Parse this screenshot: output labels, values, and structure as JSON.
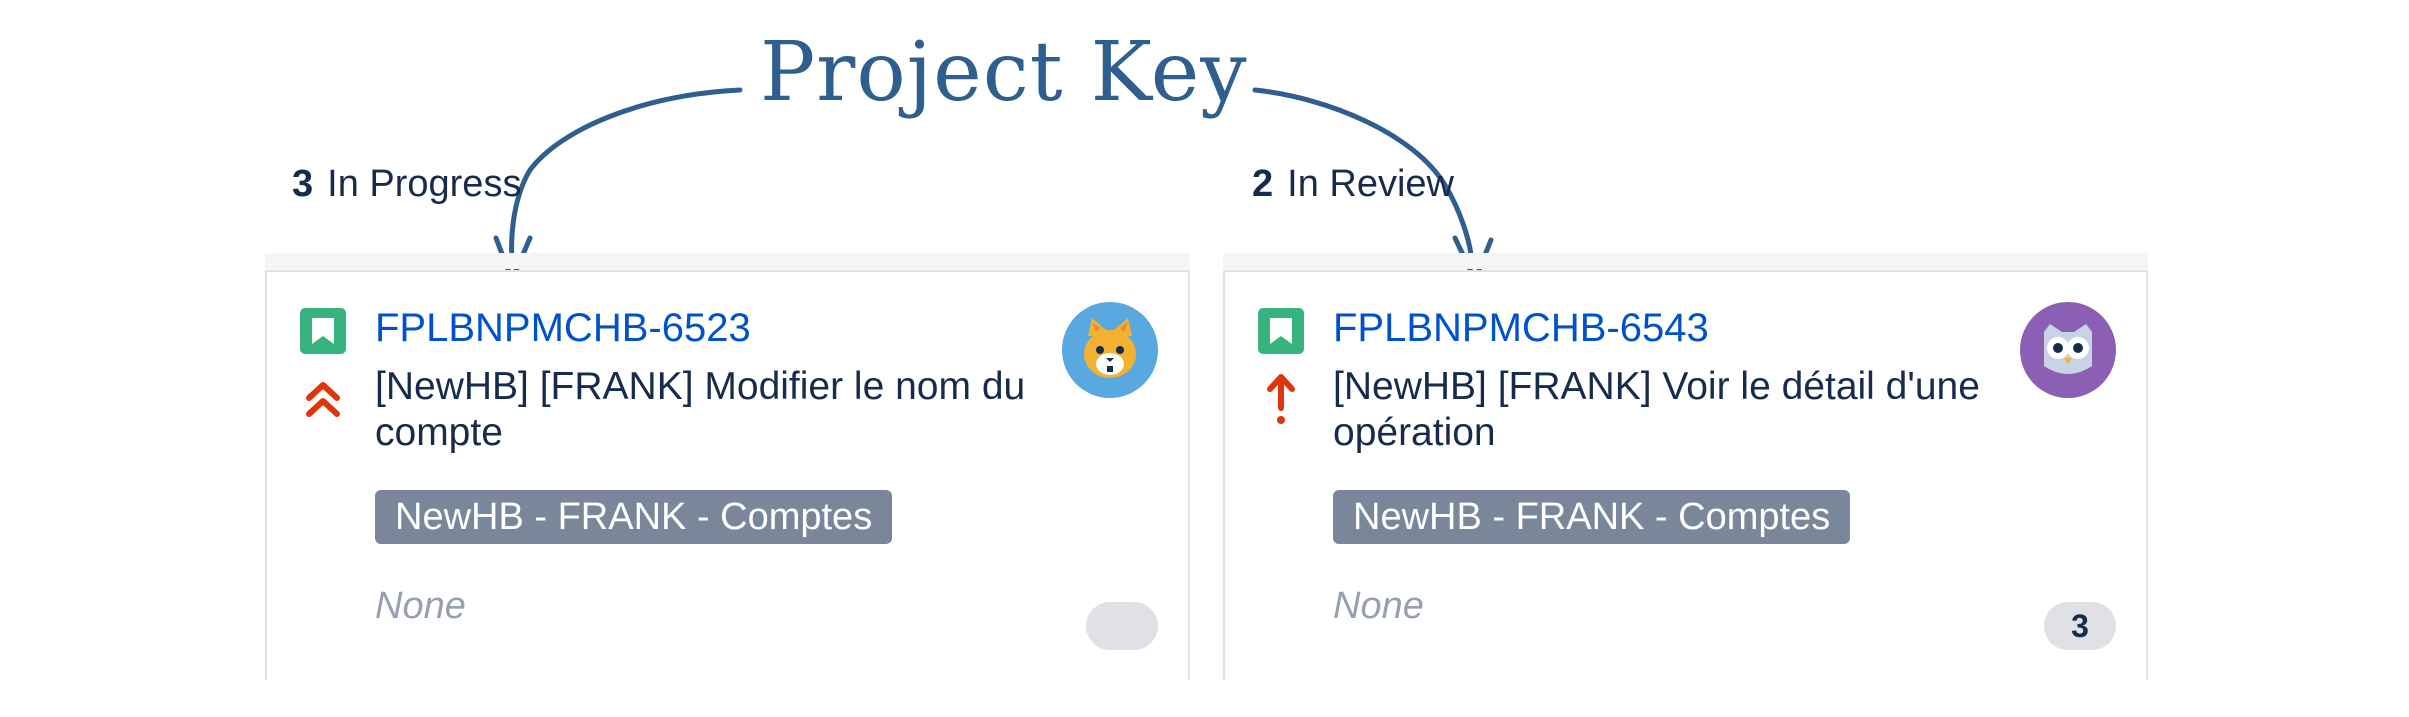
{
  "annotation": {
    "title": "Project Key"
  },
  "columns": [
    {
      "count": "3",
      "name": "In Progress",
      "card": {
        "issue_key": "FPLBNPMCHB-6523",
        "issue_type_icon": "story-bookmark-icon",
        "priority_icon": "highest-priority-double-chevron-icon",
        "summary": "[NewHB] [FRANK] Modifier le nom du compte",
        "epic": "NewHB - FRANK - Comptes",
        "version": "None",
        "estimate": "",
        "avatar_icon": "cat-avatar-icon"
      }
    },
    {
      "count": "2",
      "name": "In Review",
      "card": {
        "issue_key": "FPLBNPMCHB-6543",
        "issue_type_icon": "story-bookmark-icon",
        "priority_icon": "blocker-priority-arrow-icon",
        "summary": "[NewHB] [FRANK] Voir le détail d'une opération",
        "epic": "NewHB - FRANK - Comptes",
        "version": "None",
        "estimate": "3",
        "avatar_icon": "owl-avatar-icon"
      }
    }
  ],
  "colors": {
    "annotation": "#2f5f8f",
    "issue_key": "#0052cc",
    "story_icon": "#36b37e",
    "priority": "#de350b",
    "epic_badge": "#7a869a"
  }
}
